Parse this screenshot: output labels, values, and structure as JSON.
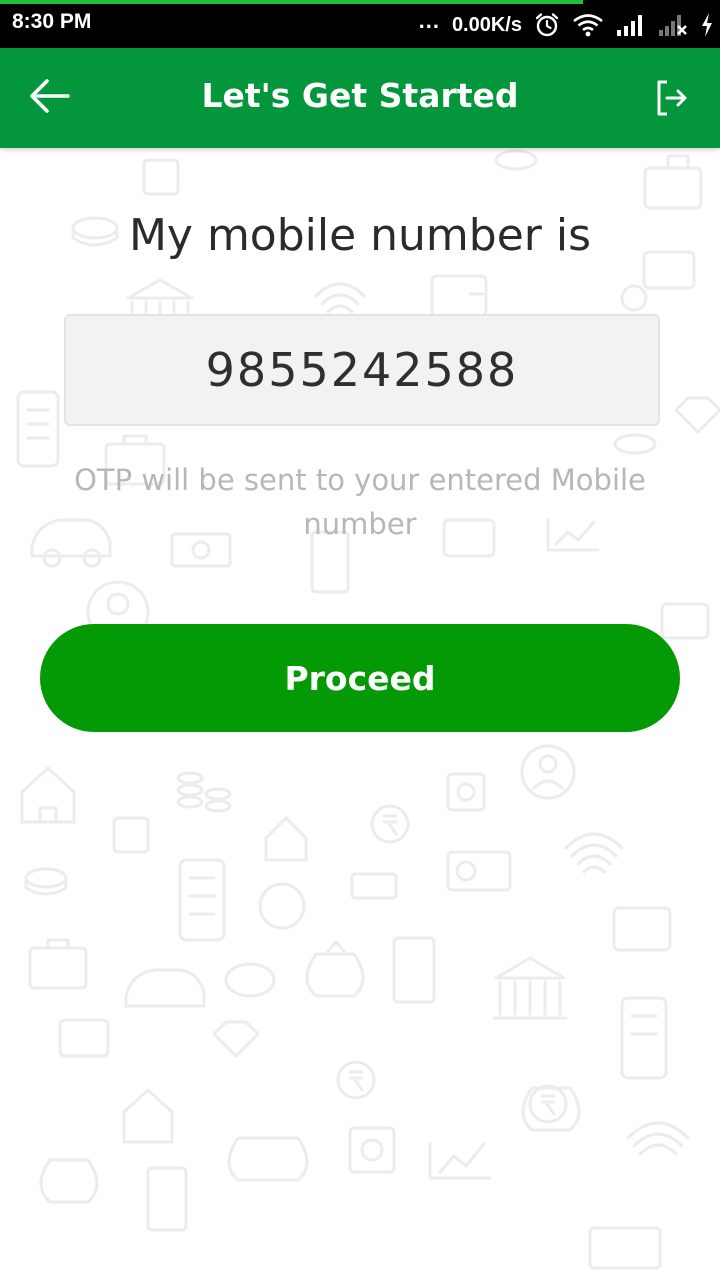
{
  "status_bar": {
    "time": "8:30 PM",
    "dots": "...",
    "network_speed": "0.00K/s",
    "icons": [
      "alarm-icon",
      "wifi-icon",
      "signal-icon",
      "signal-no-service-icon",
      "charging-icon"
    ],
    "download_progress": 0.81
  },
  "app_bar": {
    "title": "Let's Get Started",
    "back_icon": "arrow-left-icon",
    "logout_icon": "logout-icon",
    "background_color": "#03963a"
  },
  "main": {
    "heading": "My mobile number is",
    "mobile_number": "9855242588",
    "otp_note": "OTP will be sent to your entered Mobile number",
    "proceed_label": "Proceed",
    "proceed_color": "#049a06"
  }
}
